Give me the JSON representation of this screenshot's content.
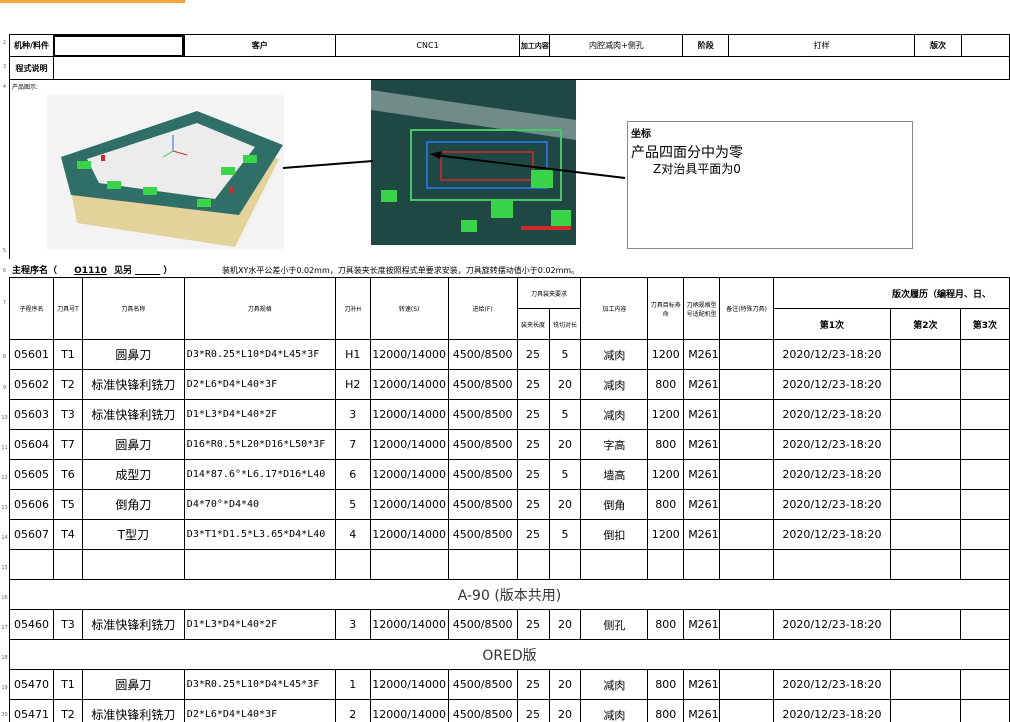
{
  "header": {
    "material_label": "机种/料件",
    "customer_label": "客户",
    "process_value": "CNC1",
    "content_label": "加工内容",
    "content_value": "内腔减肉+侧孔",
    "stage_label": "阶段",
    "stage_value": "打样",
    "version_label": "版次",
    "program_desc_label": "程式说明"
  },
  "image_section": {
    "label": "产品图示:",
    "note": {
      "title": "坐标",
      "line1": "产品四面分中为零",
      "line2": "Z对治具平面为0"
    }
  },
  "program": {
    "title_prefix": "主程序名（",
    "program_no": "O1110",
    "title_mid": "见另",
    "title_suffix": "）",
    "note": "装机XY水平公差小于0.02mm，刀具装夹长度按照程式单要求安装，刀具旋转摆动值小于0.02mm。"
  },
  "columns": {
    "sub_program": "子程序名",
    "tool_no": "刀具号T",
    "tool_name": "刀具名称",
    "tool_spec": "刀具规格",
    "tool_comp": "刀补H",
    "speed": "转速(S)",
    "feed": "进给(F)",
    "clamp_group": "刀具装夹要求",
    "clamp_length": "装夹长度",
    "clamp_flat": "铣切对长",
    "process_content": "加工内容",
    "tool_life": "刀具目标寿命",
    "machine": "刀柄规格型号适配机型",
    "remark": "备注(特殊刀具)",
    "revision_group": "版次履历（编程月、日、",
    "rev1": "第1次",
    "rev2": "第2次",
    "rev3": "第3次"
  },
  "rows": [
    {
      "sub": "05601",
      "t": "T1",
      "name": "圆鼻刀",
      "spec": "D3*R0.25*L10*D4*L45*3F",
      "h": "H1",
      "s": "12000/14000",
      "f": "4500/8500",
      "len": "25",
      "flat": "5",
      "content": "减肉",
      "life": "1200",
      "mc": "M261",
      "rev": "2020/12/23-18:20"
    },
    {
      "sub": "05602",
      "t": "T2",
      "name": "标准快锋利铣刀",
      "spec": "D2*L6*D4*L40*3F",
      "h": "H2",
      "s": "12000/14000",
      "f": "4500/8500",
      "len": "25",
      "flat": "20",
      "content": "减肉",
      "life": "800",
      "mc": "M261",
      "rev": "2020/12/23-18:20"
    },
    {
      "sub": "05603",
      "t": "T3",
      "name": "标准快锋利铣刀",
      "spec": "D1*L3*D4*L40*2F",
      "h": "3",
      "s": "12000/14000",
      "f": "4500/8500",
      "len": "25",
      "flat": "5",
      "content": "减肉",
      "life": "1200",
      "mc": "M261",
      "rev": "2020/12/23-18:20"
    },
    {
      "sub": "05604",
      "t": "T7",
      "name": "圆鼻刀",
      "spec": "D16*R0.5*L20*D16*L50*3F",
      "h": "7",
      "s": "12000/14000",
      "f": "4500/8500",
      "len": "25",
      "flat": "20",
      "content": "字高",
      "life": "800",
      "mc": "M261",
      "rev": "2020/12/23-18:20"
    },
    {
      "sub": "05605",
      "t": "T6",
      "name": "成型刀",
      "spec": "D14*87.6°*L6.17*D16*L40",
      "h": "6",
      "s": "12000/14000",
      "f": "4500/8500",
      "len": "25",
      "flat": "5",
      "content": "墙高",
      "life": "1200",
      "mc": "M261",
      "rev": "2020/12/23-18:20"
    },
    {
      "sub": "05606",
      "t": "T5",
      "name": "倒角刀",
      "spec": "D4*70°*D4*40",
      "h": "5",
      "s": "12000/14000",
      "f": "4500/8500",
      "len": "25",
      "flat": "20",
      "content": "倒角",
      "life": "800",
      "mc": "M261",
      "rev": "2020/12/23-18:20"
    },
    {
      "sub": "05607",
      "t": "T4",
      "name": "T型刀",
      "spec": "D3*T1*D1.5*L3.65*D4*L40",
      "h": "4",
      "s": "12000/14000",
      "f": "4500/8500",
      "len": "25",
      "flat": "5",
      "content": "倒扣",
      "life": "1200",
      "mc": "M261",
      "rev": "2020/12/23-18:20"
    }
  ],
  "section_a90": "A-90 (版本共用)",
  "row_a90": {
    "sub": "05460",
    "t": "T3",
    "name": "标准快锋利铣刀",
    "spec": "D1*L3*D4*L40*2F",
    "h": "3",
    "s": "12000/14000",
    "f": "4500/8500",
    "len": "25",
    "flat": "20",
    "content": "侧孔",
    "life": "800",
    "mc": "M261",
    "rev": "2020/12/23-18:20"
  },
  "section_red": "ORED版",
  "rows_red": [
    {
      "sub": "05470",
      "t": "T1",
      "name": "圆鼻刀",
      "spec": "D3*R0.25*L10*D4*L45*3F",
      "h": "1",
      "s": "12000/14000",
      "f": "4500/8500",
      "len": "25",
      "flat": "20",
      "content": "减肉",
      "life": "800",
      "mc": "M261",
      "rev": "2020/12/23-18:20"
    },
    {
      "sub": "05471",
      "t": "T2",
      "name": "标准快锋利铣刀",
      "spec": "D2*L6*D4*L40*3F",
      "h": "2",
      "s": "12000/14000",
      "f": "4500/8500",
      "len": "25",
      "flat": "20",
      "content": "减肉",
      "life": "800",
      "mc": "M261",
      "rev": "2020/12/23-18:20"
    }
  ],
  "colors": {
    "grid": "#000000",
    "selection": "#f2a33c",
    "model_teal": "#2f6f68",
    "model_green": "#39d44a",
    "model_red": "#d22b2b",
    "model_base": "#e6d49a"
  }
}
